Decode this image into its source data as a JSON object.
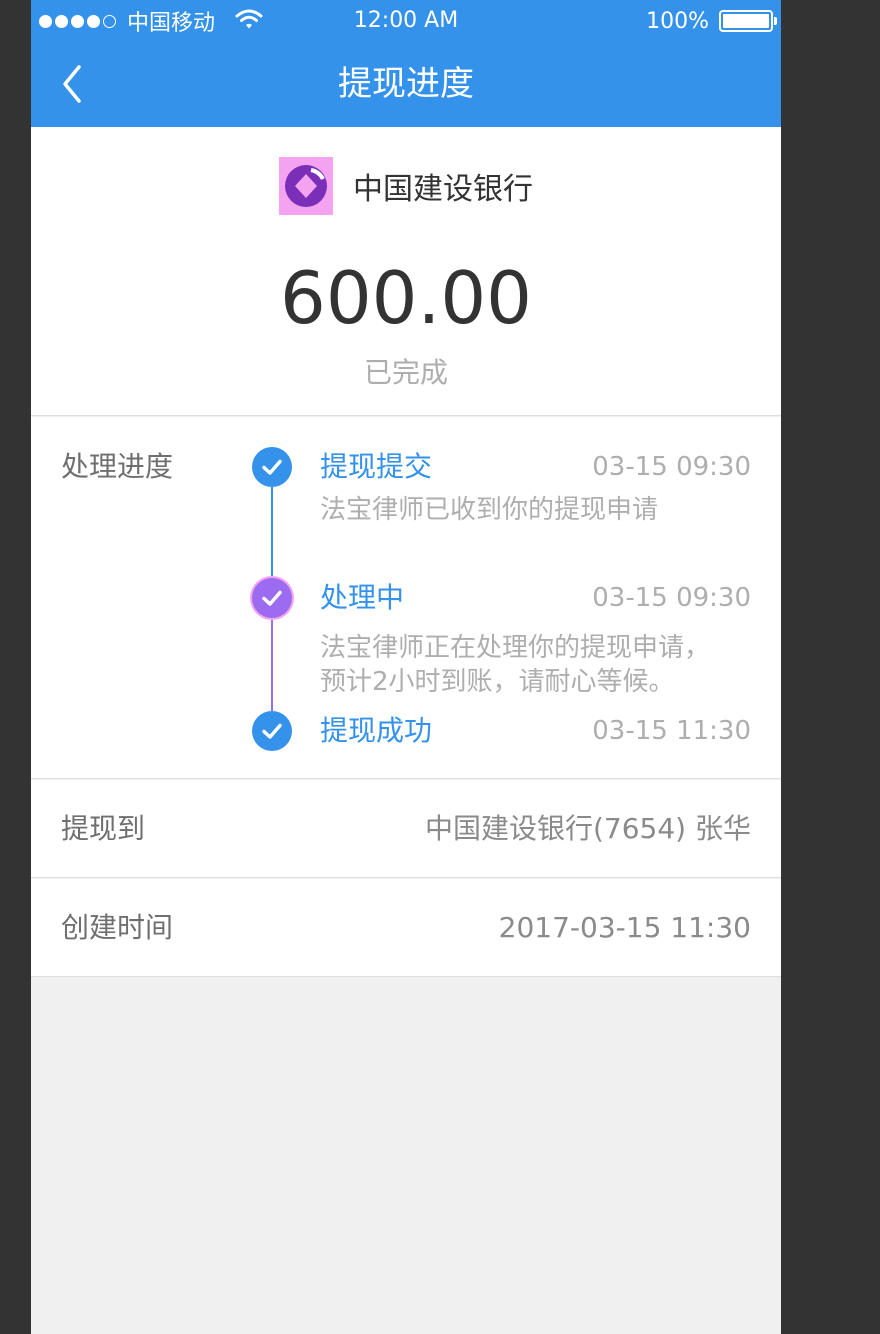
{
  "statusbar": {
    "carrier": "中国移动",
    "time": "12:00 AM",
    "battery": "100%",
    "signal_icon": "signal-dots-icon",
    "wifi_icon": "wifi-icon",
    "battery_icon": "battery-icon"
  },
  "nav": {
    "title": "提现进度",
    "back_icon": "back-arrow-icon"
  },
  "summary": {
    "bank_name": "中国建设银行",
    "bank_logo_icon": "ccb-bank-logo-icon",
    "amount": "600.00",
    "status": "已完成"
  },
  "progress": {
    "label": "处理进度",
    "steps": [
      {
        "title": "提现提交",
        "time": "03-15 09:30",
        "desc": "法宝律师已收到你的提现申请",
        "state": "done",
        "icon": "check-circle-icon"
      },
      {
        "title": "处理中",
        "time": "03-15 09:30",
        "desc_line1": "法宝律师正在处理你的提现申请，",
        "desc_line2": "预计2小时到账，请耐心等候。",
        "state": "processing",
        "icon": "processing-check-icon"
      },
      {
        "title": "提现成功",
        "time": "03-15 11:30",
        "state": "done",
        "icon": "check-circle-icon"
      }
    ]
  },
  "withdraw_to": {
    "label": "提现到",
    "value": "中国建设银行(7654) 张华"
  },
  "created": {
    "label": "创建时间",
    "value": "2017-03-15 11:30"
  },
  "colors": {
    "accent": "#3492ea",
    "text_dark": "#333333",
    "text_muted": "#aeaeae",
    "label": "#6f6f6f",
    "value": "#8a8a8a",
    "divider": "#dddddd",
    "processing": "#9b6cf0"
  }
}
